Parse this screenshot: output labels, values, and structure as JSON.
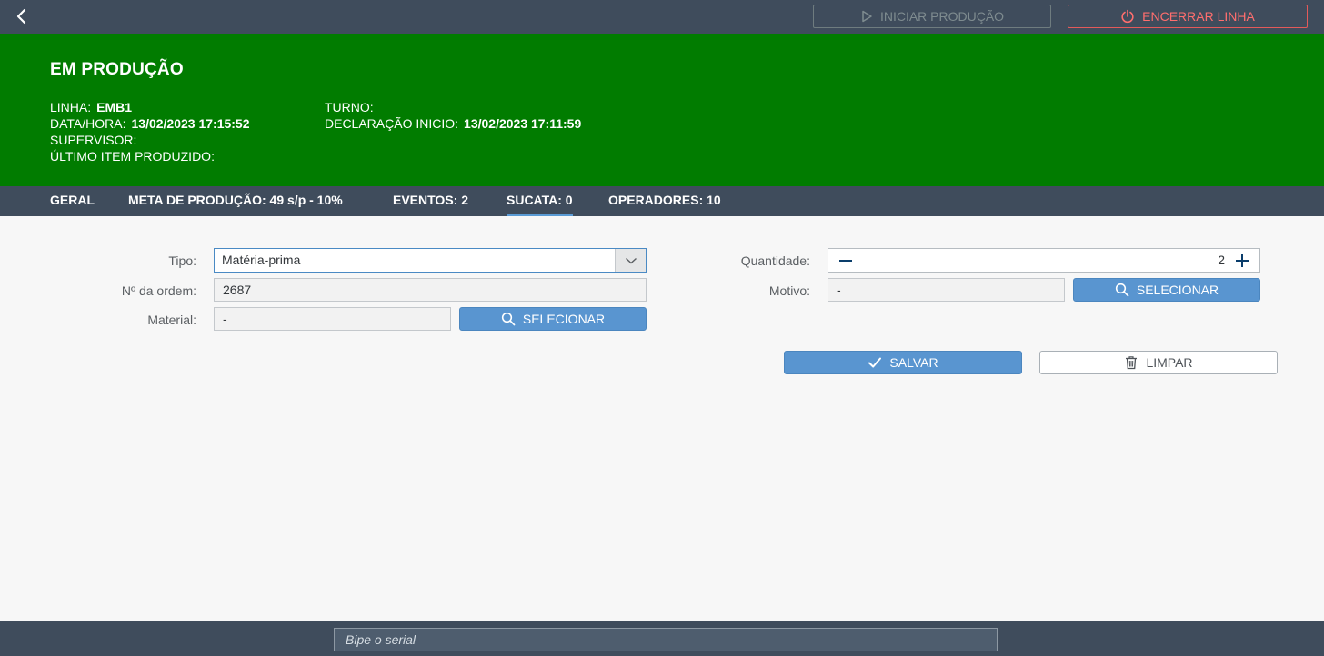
{
  "topbar": {
    "start_label": "INICIAR PRODUÇÃO",
    "end_label": "ENCERRAR LINHA",
    "colors": {
      "bar": "#3f4c5c",
      "start_text": "#7e8b8f",
      "end_text": "#ff6e6e"
    }
  },
  "status": {
    "title": "EM PRODUÇÃO",
    "background": "#017c00",
    "linha_label": "LINHA:",
    "linha_value": "EMB1",
    "datahora_label": "DATA/HORA:",
    "datahora_value": "13/02/2023 17:15:52",
    "supervisor_label": "SUPERVISOR:",
    "ultimo_label": "ÚLTIMO ITEM PRODUZIDO:",
    "turno_label": "TURNO:",
    "declaracao_label": "DECLARAÇÃO INICIO:",
    "declaracao_value": "13/02/2023 17:11:59"
  },
  "tabs": [
    {
      "label": "GERAL",
      "active": false
    },
    {
      "label": "META DE PRODUÇÃO: 49 s/p - 10%",
      "active": false
    },
    {
      "label": "EVENTOS: 2",
      "active": false
    },
    {
      "label": "SUCATA: 0",
      "active": true
    },
    {
      "label": "OPERADORES: 10",
      "active": false
    }
  ],
  "form": {
    "tipo_label": "Tipo:",
    "tipo_value": "Matéria-prima",
    "ordem_label": "Nº da ordem:",
    "ordem_value": "2687",
    "material_label": "Material:",
    "material_value": "-",
    "selecionar_label": "SELECIONAR",
    "quantidade_label": "Quantidade:",
    "quantidade_value": "2",
    "motivo_label": "Motivo:",
    "motivo_value": "-",
    "salvar_label": "SALVAR",
    "limpar_label": "LIMPAR"
  },
  "footer": {
    "serial_placeholder": "Bipe o serial"
  },
  "icons": {
    "back": "chevron-left-icon",
    "start": "play-icon",
    "end": "power-icon",
    "dropdown": "chevron-down-icon",
    "search": "search-icon",
    "minus": "minus-icon",
    "plus": "plus-icon",
    "save": "check-icon",
    "clear": "trash-icon"
  }
}
